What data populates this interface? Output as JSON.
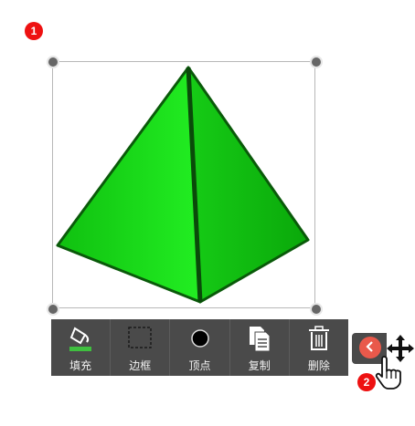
{
  "badges": {
    "first": "1",
    "second": "2"
  },
  "toolbar": {
    "items": [
      {
        "label": "填充",
        "icon": "paint-bucket-icon"
      },
      {
        "label": "边框",
        "icon": "dashed-square-icon"
      },
      {
        "label": "顶点",
        "icon": "dot-icon"
      },
      {
        "label": "复制",
        "icon": "copy-pages-icon"
      },
      {
        "label": "删除",
        "icon": "trash-icon"
      }
    ]
  },
  "collapse": {
    "icon": "chevron-left-icon"
  },
  "cursors": [
    "move-arrows-icon",
    "hand-pointer-icon"
  ],
  "colors": {
    "pyramid_fill": "#18d418",
    "pyramid_edge": "#0a5a0a",
    "toolbar_bg": "#4a4a4a",
    "accent": "#e9594b",
    "badge": "#ee1111"
  }
}
